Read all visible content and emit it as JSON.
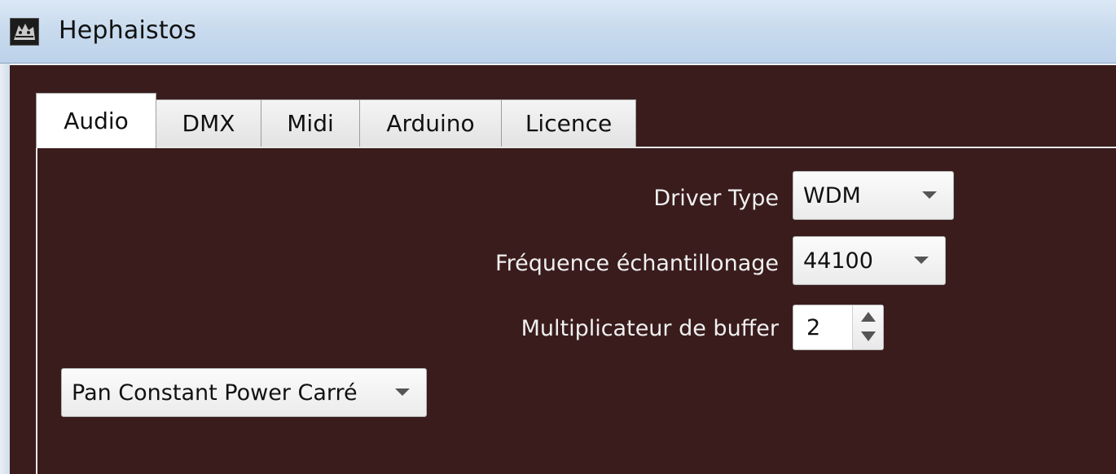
{
  "window": {
    "title": "Hephaistos",
    "icon": "hephaistos-app-icon"
  },
  "tabs": [
    {
      "label": "Audio",
      "active": true
    },
    {
      "label": "DMX",
      "active": false
    },
    {
      "label": "Midi",
      "active": false
    },
    {
      "label": "Arduino",
      "active": false
    },
    {
      "label": "Licence",
      "active": false
    }
  ],
  "audio": {
    "driver_type": {
      "label": "Driver Type",
      "value": "WDM"
    },
    "sample_rate": {
      "label": "Fréquence échantillonage",
      "value": "44100"
    },
    "buffer_multiplier": {
      "label": "Multiplicateur de buffer",
      "value": "2"
    },
    "pan_mode": {
      "value": "Pan Constant Power Carré"
    }
  },
  "colors": {
    "panel_background": "#3a1c1c",
    "titlebar": "#c9dbee",
    "label_text": "#f0f0f0"
  }
}
